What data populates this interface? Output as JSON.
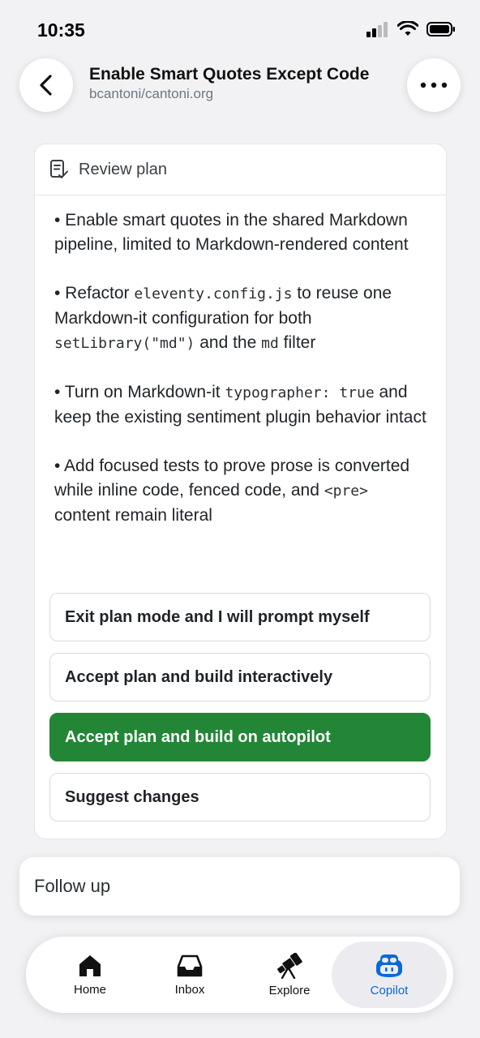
{
  "status_bar": {
    "time": "10:35"
  },
  "header": {
    "title": "Enable Smart Quotes Except Code",
    "repo": "bcantoni/cantoni.org"
  },
  "card": {
    "header_label": "Review plan",
    "plan": [
      {
        "parts": [
          {
            "t": "• Enable smart quotes in the shared Markdown pipeline, limited to Markdown-rendered content"
          }
        ]
      },
      {
        "parts": [
          {
            "t": "• Refactor "
          },
          {
            "c": "eleventy.config.js"
          },
          {
            "t": " to reuse one Markdown-it configuration for both "
          },
          {
            "c": "setLibrary(\"md\")"
          },
          {
            "t": " and the "
          },
          {
            "c": "md"
          },
          {
            "t": " filter"
          }
        ]
      },
      {
        "parts": [
          {
            "t": "• Turn on Markdown-it "
          },
          {
            "c": "typographer: true"
          },
          {
            "t": " and keep the existing sentiment plugin behavior intact"
          }
        ]
      },
      {
        "parts": [
          {
            "t": "• Add focused tests to prove prose is converted while inline code, fenced code, and "
          },
          {
            "c": "<pre>"
          },
          {
            "t": " content remain literal"
          }
        ]
      }
    ],
    "options": [
      "Exit plan mode and I will prompt myself",
      "Accept plan and build interactively",
      "Accept plan and build on autopilot",
      "Suggest changes"
    ]
  },
  "follow_up": {
    "placeholder": "Follow up"
  },
  "tabs": [
    {
      "label": "Home",
      "icon": "home-icon"
    },
    {
      "label": "Inbox",
      "icon": "inbox-icon"
    },
    {
      "label": "Explore",
      "icon": "telescope-icon"
    },
    {
      "label": "Copilot",
      "icon": "copilot-icon",
      "active": true
    }
  ],
  "colors": {
    "accent_green": "#238636",
    "active_tab": "#0969da"
  }
}
